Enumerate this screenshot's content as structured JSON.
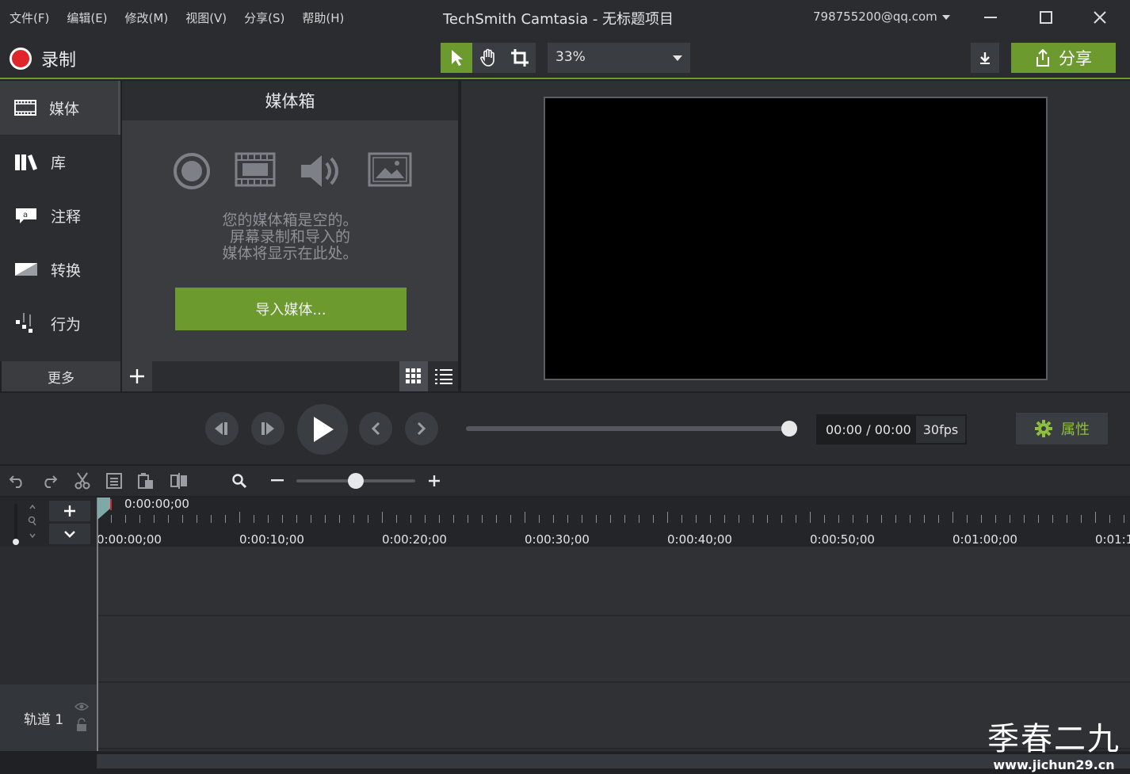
{
  "menu": [
    "文件(F)",
    "编辑(E)",
    "修改(M)",
    "视图(V)",
    "分享(S)",
    "帮助(H)"
  ],
  "window_title": "TechSmith Camtasia - 无标题项目",
  "account": "798755200@qq.com",
  "toolbar": {
    "record_label": "录制",
    "zoom_value": "33%",
    "share_label": "分享"
  },
  "sidebar": {
    "items": [
      {
        "label": "媒体",
        "icon": "filmstrip-icon"
      },
      {
        "label": "库",
        "icon": "library-icon"
      },
      {
        "label": "注释",
        "icon": "annotation-icon"
      },
      {
        "label": "转换",
        "icon": "transition-icon"
      },
      {
        "label": "行为",
        "icon": "behavior-icon"
      }
    ],
    "more_label": "更多"
  },
  "media_bin": {
    "title": "媒体箱",
    "empty_line1": "您的媒体箱是空的。",
    "empty_line2": "屏幕录制和导入的",
    "empty_line3": "媒体将显示在此处。",
    "import_label": "导入媒体..."
  },
  "playback": {
    "current_time": "00:00",
    "separator": "/",
    "total_time": "00:00",
    "fps": "30fps",
    "properties_label": "属性"
  },
  "timeline": {
    "playhead_time": "0:00:00;00",
    "ruler_labels": [
      "0:00:00;00",
      "0:00:10;00",
      "0:00:20;00",
      "0:00:30;00",
      "0:00:40;00",
      "0:00:50;00",
      "0:01:00;00",
      "0:01:1"
    ],
    "track_label": "轨道 1"
  },
  "colors": {
    "accent": "#6d9a2e",
    "record": "#e0262b",
    "background": "#1f2124"
  },
  "watermark": {
    "text": "季春二九",
    "url": "www.jichun29.cn"
  }
}
